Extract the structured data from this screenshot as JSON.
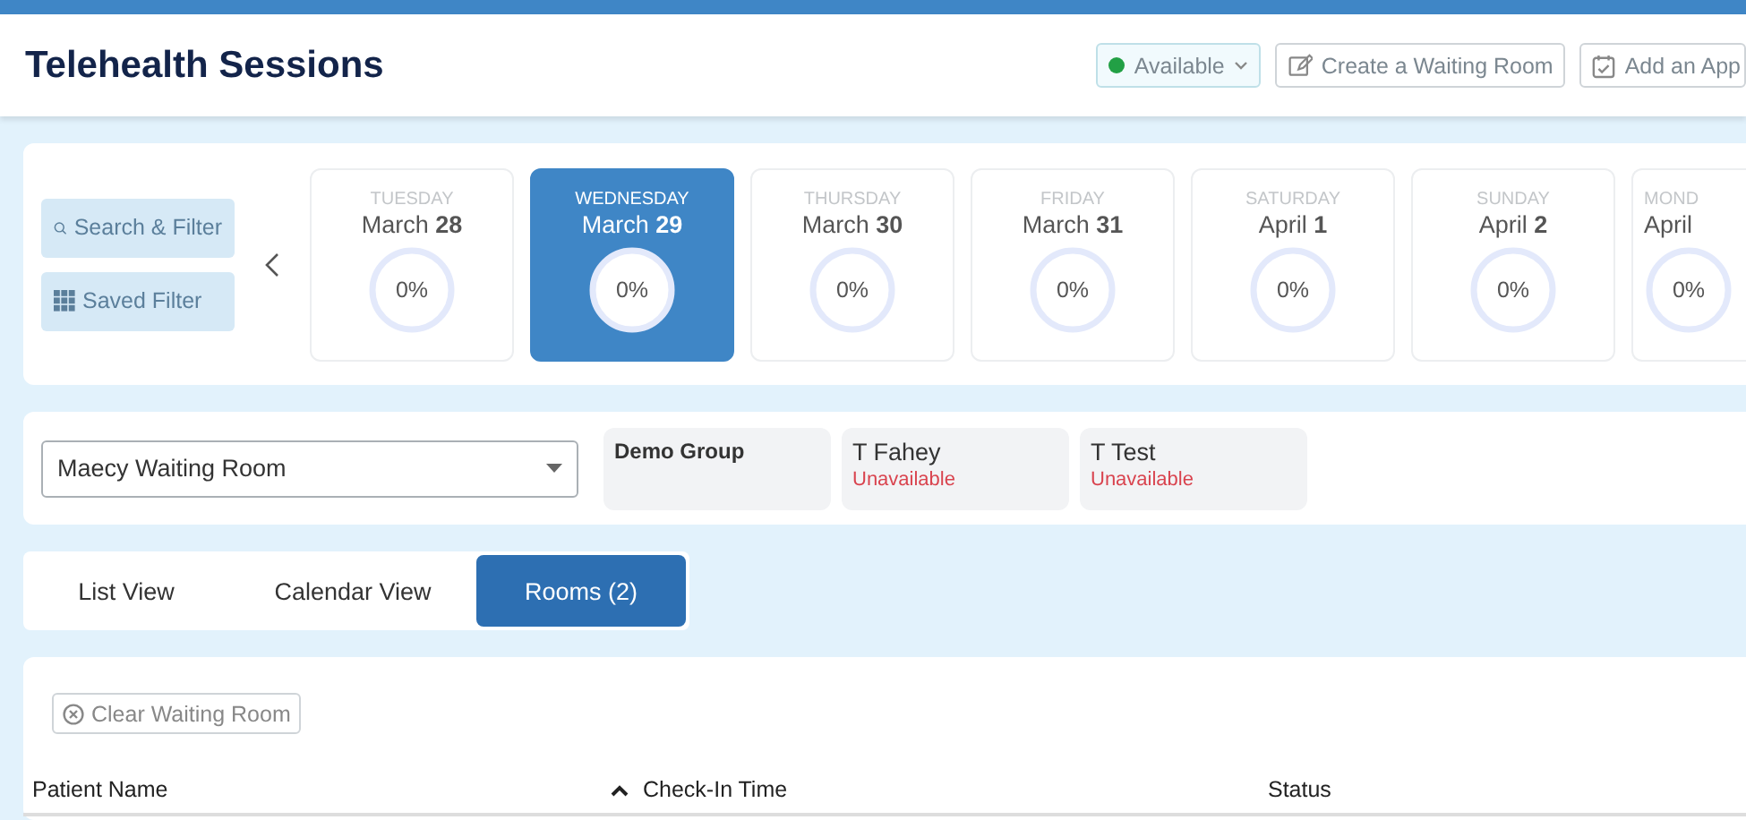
{
  "header": {
    "title": "Telehealth Sessions",
    "status": {
      "label": "Available",
      "color": "#22a045"
    },
    "actions": [
      {
        "label": "Create a Waiting Room",
        "kind": "edit"
      },
      {
        "label": "Add an App",
        "kind": "calendar"
      }
    ]
  },
  "filters": [
    {
      "label": "Search & Filter",
      "kind": "search"
    },
    {
      "label": "Saved Filter",
      "kind": "grid"
    }
  ],
  "days": [
    {
      "weekday": "TUESDAY",
      "month": "March",
      "date": "28",
      "percent": "0%",
      "level": 0,
      "selected": false
    },
    {
      "weekday": "WEDNESDAY",
      "month": "March",
      "date": "29",
      "percent": "0%",
      "level": 0,
      "selected": true
    },
    {
      "weekday": "THURSDAY",
      "month": "March",
      "date": "30",
      "percent": "0%",
      "level": 0,
      "selected": false
    },
    {
      "weekday": "FRIDAY",
      "month": "March",
      "date": "31",
      "percent": "0%",
      "level": 0,
      "selected": false
    },
    {
      "weekday": "SATURDAY",
      "month": "April",
      "date": "1",
      "percent": "0%",
      "level": 0,
      "selected": false
    },
    {
      "weekday": "SUNDAY",
      "month": "April",
      "date": "2",
      "percent": "0%",
      "level": 0,
      "selected": false
    },
    {
      "weekday": "MOND",
      "month": "April",
      "percent": "0%",
      "level": 0,
      "selected": false
    }
  ],
  "room_select": {
    "value": "Maecy Waiting Room"
  },
  "providers": [
    {
      "name": "Demo Group",
      "kind": "group"
    },
    {
      "name": "T Fahey",
      "status": "Unavailable",
      "kind": "person"
    },
    {
      "name": "T Test",
      "status": "Unavailable",
      "kind": "person"
    }
  ],
  "tabs": [
    {
      "label": "List View",
      "selected": false
    },
    {
      "label": "Calendar View",
      "selected": false
    },
    {
      "label": "Rooms (2)",
      "selected": true
    }
  ],
  "clear_button": "Clear Waiting Room",
  "table": {
    "columns": [
      {
        "label": "Patient Name",
        "sorted": false
      },
      {
        "label": "Check-In Time",
        "sorted": true
      },
      {
        "label": "Status",
        "sorted": false
      }
    ]
  }
}
